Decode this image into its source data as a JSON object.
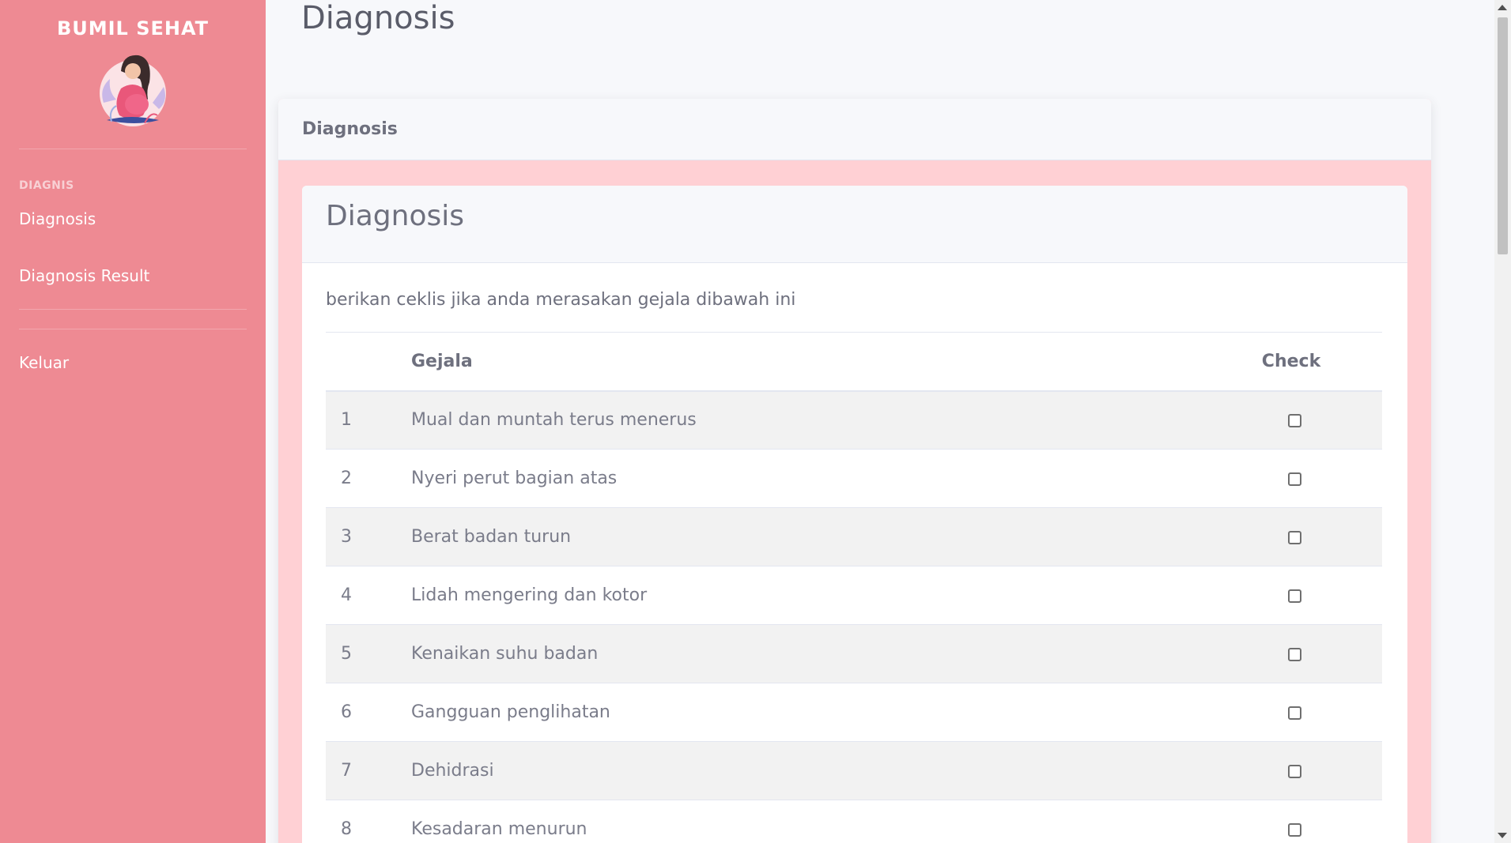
{
  "sidebar": {
    "brand": "BUMIL SEHAT",
    "section_heading": "DIAGNIS",
    "items": [
      {
        "label": "Diagnosis"
      },
      {
        "label": "Diagnosis Result"
      },
      {
        "label": "Keluar"
      }
    ]
  },
  "page": {
    "title": "Diagnosis",
    "card_header": "Diagnosis",
    "inner_title": "Diagnosis",
    "instruction": "berikan ceklis jika anda merasakan gejala dibawah ini"
  },
  "table": {
    "columns": [
      "",
      "Gejala",
      "Check"
    ],
    "rows": [
      {
        "no": "1",
        "gejala": "Mual dan muntah terus menerus",
        "checked": false
      },
      {
        "no": "2",
        "gejala": "Nyeri perut bagian atas",
        "checked": false
      },
      {
        "no": "3",
        "gejala": "Berat badan turun",
        "checked": false
      },
      {
        "no": "4",
        "gejala": "Lidah mengering dan kotor",
        "checked": false
      },
      {
        "no": "5",
        "gejala": "Kenaikan suhu badan",
        "checked": false
      },
      {
        "no": "6",
        "gejala": "Gangguan penglihatan",
        "checked": false
      },
      {
        "no": "7",
        "gejala": "Dehidrasi",
        "checked": false
      },
      {
        "no": "8",
        "gejala": "Kesadaran menurun",
        "checked": false
      }
    ]
  },
  "colors": {
    "sidebar_bg": "#ee8a93",
    "card_accent": "#ffd0d4",
    "text_muted": "#6e707e"
  },
  "icons": {
    "logo": "pregnant-woman-illustration"
  }
}
